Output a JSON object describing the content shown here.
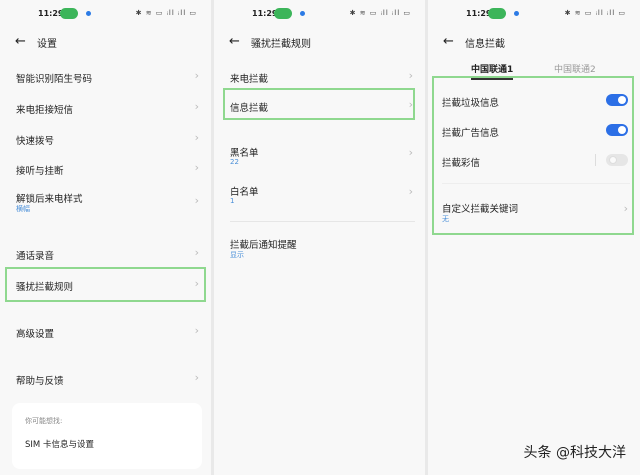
{
  "status": {
    "time": "11:29",
    "icons": "✱ ≋ ▭ ᵢll ᵢll ▭"
  },
  "panel1": {
    "title": "设置",
    "items": [
      {
        "label": "智能识别陌生号码"
      },
      {
        "label": "来电拒接短信"
      },
      {
        "label": "快速拨号"
      },
      {
        "label": "接听与挂断"
      },
      {
        "label": "解锁后来电样式",
        "sub": "横幅"
      },
      {
        "label": "通话录音"
      },
      {
        "label": "骚扰拦截规则"
      },
      {
        "label": "高级设置"
      },
      {
        "label": "帮助与反馈"
      }
    ],
    "suggest": {
      "heading": "你可能想找:",
      "item": "SIM 卡信息与设置"
    }
  },
  "panel2": {
    "title": "骚扰拦截规则",
    "items": [
      {
        "label": "来电拦截"
      },
      {
        "label": "信息拦截"
      },
      {
        "label": "黑名单",
        "sub": "22"
      },
      {
        "label": "白名单",
        "sub": "1"
      },
      {
        "label": "拦截后通知提醒",
        "sub": "显示"
      }
    ]
  },
  "panel3": {
    "title": "信息拦截",
    "tabs": [
      "中国联通1",
      "中国联通2"
    ],
    "toggles": [
      {
        "label": "拦截垃圾信息",
        "on": true
      },
      {
        "label": "拦截广告信息",
        "on": true
      },
      {
        "label": "拦截彩信",
        "on": false
      }
    ],
    "keyword": {
      "label": "自定义拦截关键词",
      "sub": "无"
    }
  },
  "watermark": "头条 @科技大洋",
  "colors": {
    "accent": "#2c6fe6",
    "highlight": "#8fd88f",
    "sub": "#4a8fd8"
  }
}
